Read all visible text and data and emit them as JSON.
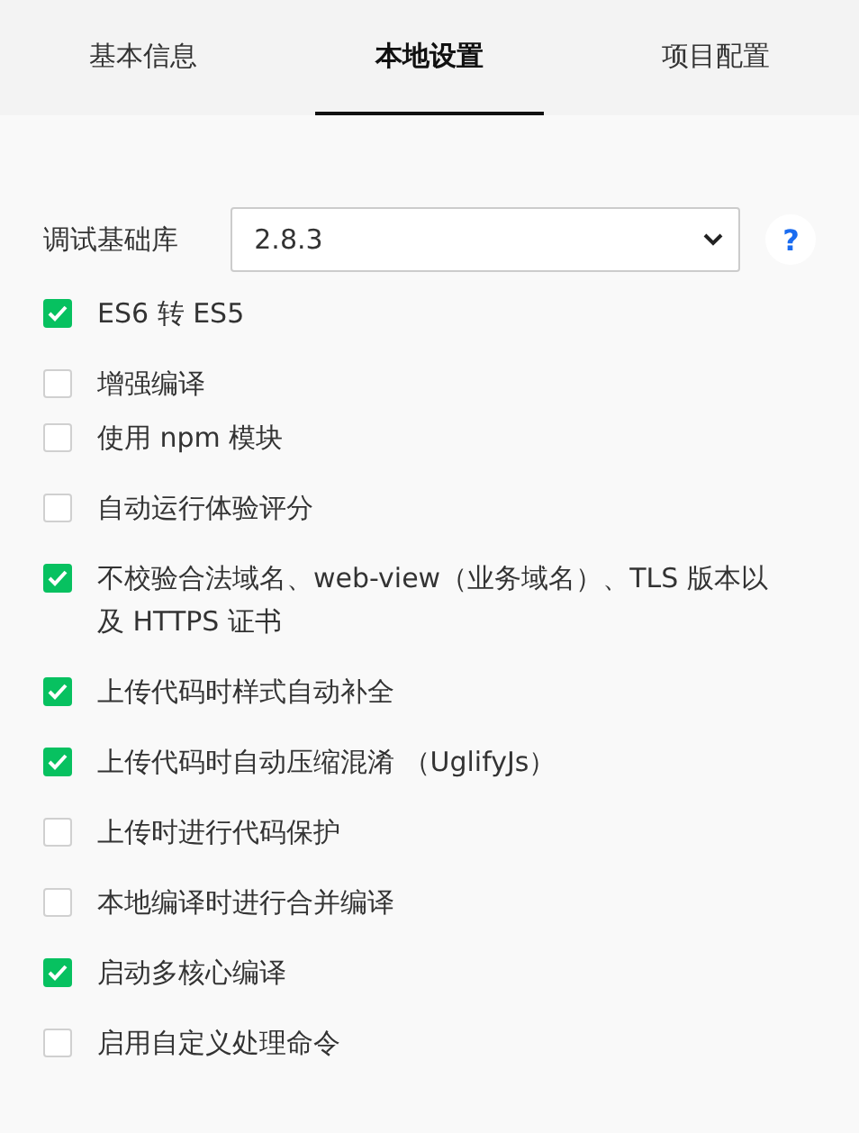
{
  "tabs": [
    {
      "label": "基本信息",
      "selected": false
    },
    {
      "label": "本地设置",
      "selected": true
    },
    {
      "label": "项目配置",
      "selected": false
    }
  ],
  "library": {
    "label": "调试基础库",
    "value": "2.8.3",
    "help": "?"
  },
  "option_groups": [
    [
      {
        "label": "ES6 转 ES5",
        "checked": true
      }
    ],
    [
      {
        "label": "增强编译",
        "checked": false
      },
      {
        "label": "使用 npm 模块",
        "checked": false
      }
    ],
    [
      {
        "label": "自动运行体验评分",
        "checked": false
      }
    ],
    [
      {
        "label": "不校验合法域名、web-view（业务域名）、TLS 版本以及 HTTPS 证书",
        "checked": true
      }
    ],
    [
      {
        "label": "上传代码时样式自动补全",
        "checked": true
      }
    ],
    [
      {
        "label": "上传代码时自动压缩混淆 （UglifyJs）",
        "checked": true
      }
    ],
    [
      {
        "label": "上传时进行代码保护",
        "checked": false
      }
    ],
    [
      {
        "label": "本地编译时进行合并编译",
        "checked": false
      }
    ],
    [
      {
        "label": "启动多核心编译",
        "checked": true
      }
    ],
    [
      {
        "label": "启用自定义处理命令",
        "checked": false
      }
    ]
  ]
}
